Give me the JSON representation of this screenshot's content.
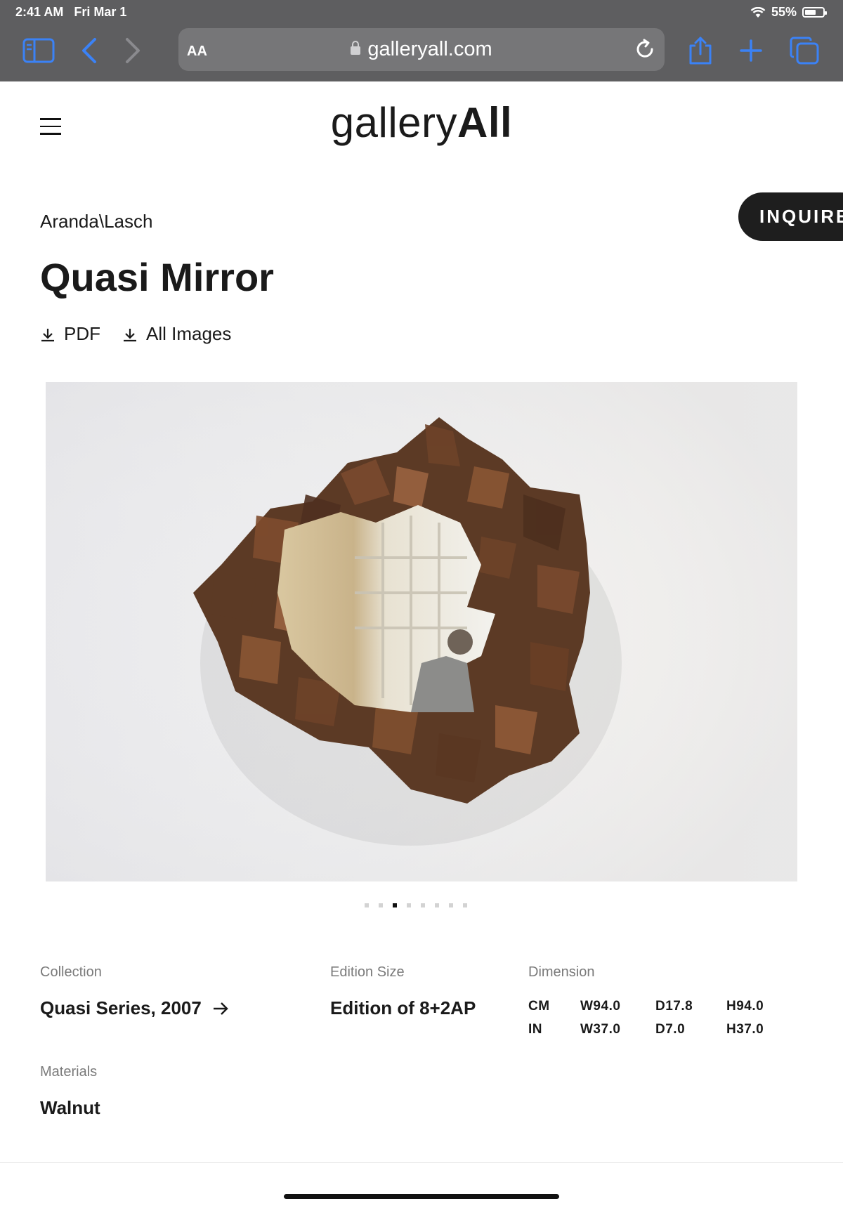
{
  "status": {
    "time": "2:41 AM",
    "date": "Fri Mar 1",
    "battery": "55%"
  },
  "browser": {
    "aa": "AA",
    "url": "galleryall.com"
  },
  "site": {
    "logo_light": "gallery",
    "logo_bold": "All"
  },
  "product": {
    "artist": "Aranda\\Lasch",
    "title": "Quasi Mirror",
    "inquire": "INQUIRE",
    "downloads": {
      "pdf": "PDF",
      "images": "All Images"
    }
  },
  "carousel": {
    "count": 8,
    "active_index": 2
  },
  "details": {
    "collection_label": "Collection",
    "collection_value": "Quasi Series, 2007",
    "edition_label": "Edition Size",
    "edition_value": "Edition of 8+2AP",
    "dimension_label": "Dimension",
    "dimensions": [
      {
        "unit": "CM",
        "w": "W94.0",
        "d": "D17.8",
        "h": "H94.0"
      },
      {
        "unit": "IN",
        "w": "W37.0",
        "d": "D7.0",
        "h": "H37.0"
      }
    ],
    "materials_label": "Materials",
    "materials_value": "Walnut"
  },
  "colors": {
    "chrome": "#5e5e60",
    "accent": "#2f7bf5",
    "button": "#1e1e1e"
  }
}
